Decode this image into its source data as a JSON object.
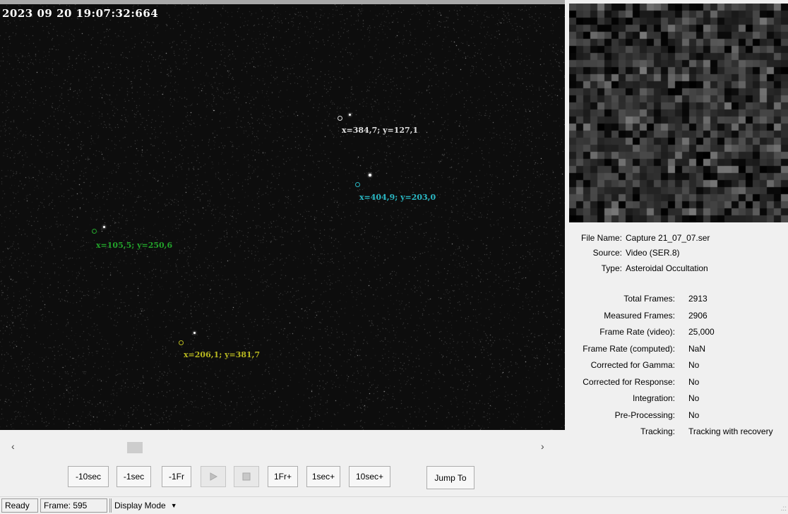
{
  "video": {
    "timestamp": "2023 09 20 19:07:32:664",
    "targets": [
      {
        "label": "x=384,7; y=127,1",
        "color": "#e0e0e0"
      },
      {
        "label": "x=404,9; y=203,0",
        "color": "#2ab8c4"
      },
      {
        "label": "x=105,5; y=250,6",
        "color": "#22a22a"
      },
      {
        "label": "x=206,1; y=381,7",
        "color": "#b8b820"
      }
    ]
  },
  "info": {
    "file_name_label": "File Name:",
    "file_name_value": "Capture 21_07_07.ser",
    "source_label": "Source:",
    "source_value": "Video (SER.8)",
    "type_label": "Type:",
    "type_value": "Asteroidal Occultation",
    "stats": [
      {
        "label": "Total Frames:",
        "value": "2913"
      },
      {
        "label": "Measured Frames:",
        "value": "2906"
      },
      {
        "label": "Frame Rate (video):",
        "value": "25,000"
      },
      {
        "label": "Frame Rate (computed):",
        "value": "NaN"
      },
      {
        "label": "Corrected for Gamma:",
        "value": "No"
      },
      {
        "label": "Corrected for Response:",
        "value": "No"
      },
      {
        "label": "Integration:",
        "value": "No"
      },
      {
        "label": "Pre-Processing:",
        "value": "No"
      },
      {
        "label": "Tracking:",
        "value": "Tracking with recovery"
      }
    ]
  },
  "controls": {
    "minus10sec": "-10sec",
    "minus1sec": "-1sec",
    "minus1fr": "-1Fr",
    "plus1fr": "1Fr+",
    "plus1sec": "1sec+",
    "plus10sec": "10sec+",
    "jump_to": "Jump To"
  },
  "scrollbar": {
    "left_arrow": "‹",
    "right_arrow": "›"
  },
  "statusbar": {
    "ready": "Ready",
    "frame": "Frame: 595",
    "display_mode": "Display Mode",
    "dropdown_arrow": "▼",
    "grip": ".::"
  }
}
